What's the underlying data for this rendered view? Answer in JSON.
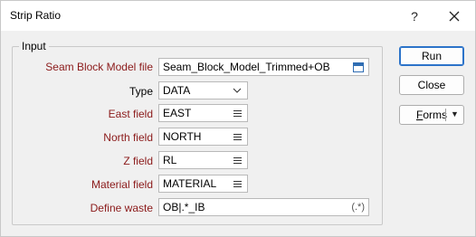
{
  "window": {
    "title": "Strip Ratio",
    "help_icon": "?",
    "close_icon": "×"
  },
  "group": {
    "label": "Input"
  },
  "fields": {
    "seam_block_model_file": {
      "label": "Seam Block Model file",
      "value": "Seam_Block_Model_Trimmed+OB",
      "icon": "browse-file-icon"
    },
    "type": {
      "label": "Type",
      "value": "DATA",
      "icon": "chevron-down-icon"
    },
    "east_field": {
      "label": "East field",
      "value": "EAST",
      "icon": "list-menu-icon"
    },
    "north_field": {
      "label": "North field",
      "value": "NORTH",
      "icon": "list-menu-icon"
    },
    "z_field": {
      "label": "Z field",
      "value": "RL",
      "icon": "list-menu-icon"
    },
    "material_field": {
      "label": "Material field",
      "value": "MATERIAL",
      "icon": "list-menu-icon"
    },
    "define_waste": {
      "label": "Define waste",
      "value": "OB|.*_IB",
      "regex_marker": "(.*)"
    }
  },
  "buttons": {
    "run": "Run",
    "close": "Close",
    "forms_underlined": "F",
    "forms_rest": "orms",
    "forms_arrow": "▼"
  },
  "colors": {
    "required_label": "#8b1a1a",
    "primary_border": "#2c73c9"
  }
}
